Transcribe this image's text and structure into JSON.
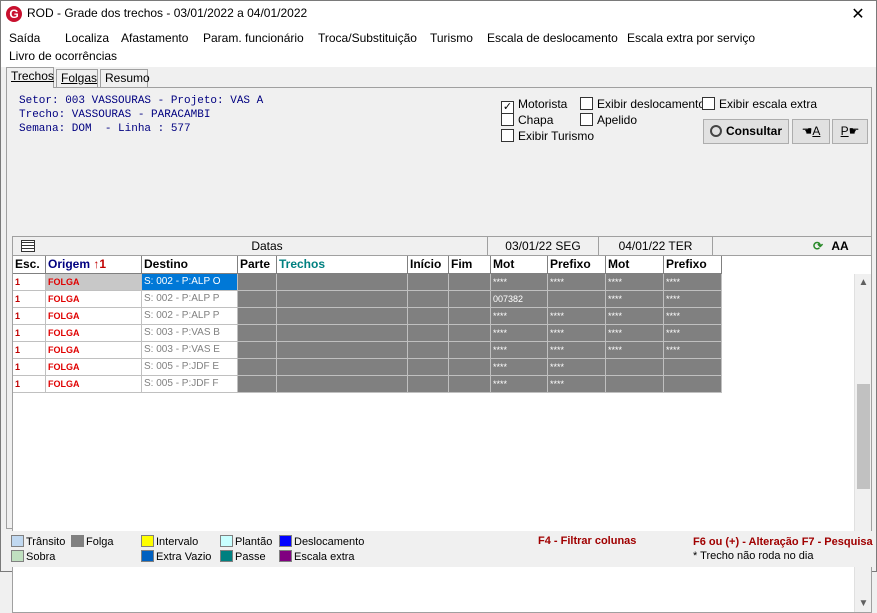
{
  "window": {
    "title": "ROD - Grade dos trechos  -  03/01/2022 a 04/01/2022",
    "close_glyph": "✕",
    "app_icon_letter": "G"
  },
  "menu": [
    "Saída",
    "Localiza",
    "Afastamento",
    "Param. funcionário",
    "Troca/Substituição",
    "Turismo",
    "Escala de deslocamento",
    "Escala extra por serviço",
    "Livro de ocorrências"
  ],
  "tabs": [
    "Trechos",
    "Folgas",
    "Resumo"
  ],
  "info": {
    "line1": "Setor: 003 VASSOURAS - Projeto: VAS A",
    "line2": "Trecho: VASSOURAS - PARACAMBI",
    "line3": "Semana: DOM  - Linha : 577"
  },
  "options": {
    "motorista": {
      "label": "Motorista",
      "checked": true
    },
    "chapa": {
      "label": "Chapa",
      "checked": false
    },
    "exibir_turismo": {
      "label": "Exibir Turismo",
      "checked": false
    },
    "exibir_deslocamento": {
      "label": "Exibir deslocamento",
      "checked": false
    },
    "apelido": {
      "label": "Apelido",
      "checked": false
    },
    "exibir_escala_extra": {
      "label": "Exibir escala extra",
      "checked": false
    }
  },
  "buttons": {
    "consultar": "Consultar",
    "prev_label": "A",
    "next_label": "P"
  },
  "grid": {
    "band": {
      "datas": "Datas",
      "date1": "03/01/22 SEG",
      "date2": "04/01/22 TER"
    },
    "columns": [
      "Esc.",
      "Origem",
      "Destino",
      "Parte",
      "Trechos",
      "Início",
      "Fim",
      "Mot",
      "Prefixo",
      "Mot",
      "Prefixo"
    ],
    "sort_marker": "1",
    "rows": [
      {
        "esc": "1",
        "origem": "FOLGA",
        "destino": "S: 002 - P:ALP O",
        "mot1": "****",
        "pref1": "****",
        "mot2": "****",
        "pref2": "****"
      },
      {
        "esc": "1",
        "origem": "FOLGA",
        "destino": "S: 002 - P:ALP P",
        "mot1": "007382",
        "pref1": "",
        "mot2": "****",
        "pref2": "****"
      },
      {
        "esc": "1",
        "origem": "FOLGA",
        "destino": "S: 002 - P:ALP P",
        "mot1": "****",
        "pref1": "****",
        "mot2": "****",
        "pref2": "****"
      },
      {
        "esc": "1",
        "origem": "FOLGA",
        "destino": "S: 003 - P:VAS B",
        "mot1": "****",
        "pref1": "****",
        "mot2": "****",
        "pref2": "****"
      },
      {
        "esc": "1",
        "origem": "FOLGA",
        "destino": "S: 003 - P:VAS E",
        "mot1": "****",
        "pref1": "****",
        "mot2": "****",
        "pref2": "****"
      },
      {
        "esc": "1",
        "origem": "FOLGA",
        "destino": "S: 005 - P:JDF E",
        "mot1": "****",
        "pref1": "****",
        "mot2": "",
        "pref2": ""
      },
      {
        "esc": "1",
        "origem": "FOLGA",
        "destino": "S: 005 - P:JDF F",
        "mot1": "****",
        "pref1": "****",
        "mot2": "",
        "pref2": ""
      }
    ]
  },
  "legend": [
    {
      "label": "Trânsito",
      "color": "#c0d8f0"
    },
    {
      "label": "Folga",
      "color": "#808080"
    },
    {
      "label": "Intervalo",
      "color": "#ffff00"
    },
    {
      "label": "Plantão",
      "color": "#c8ffff"
    },
    {
      "label": "Deslocamento",
      "color": "#0000ff"
    },
    {
      "label": "Sobra",
      "color": "#c0e0c0"
    },
    {
      "label": "Extra Vazio",
      "color": "#0060c0"
    },
    {
      "label": "Passe",
      "color": "#008080"
    },
    {
      "label": "Escala extra",
      "color": "#800080"
    }
  ],
  "hints": {
    "f4": "F4 - Filtrar colunas",
    "f6": "F6 ou (+) - Alteração  F7 - Pesquisa",
    "note": "* Trecho não roda no dia"
  }
}
